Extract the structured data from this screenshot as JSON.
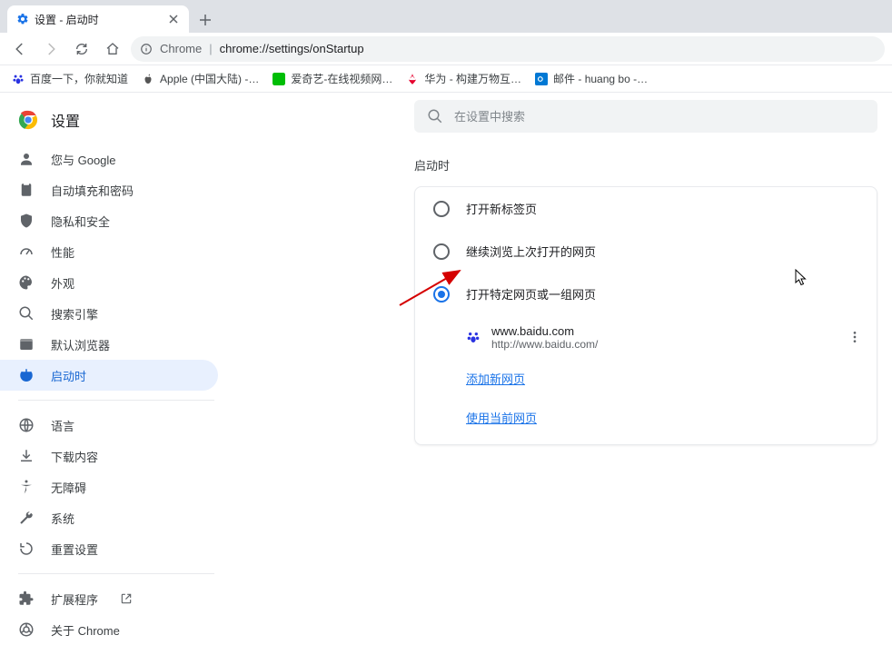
{
  "tab": {
    "title": "设置 - 启动时"
  },
  "omnibox": {
    "origin": "Chrome",
    "path": "chrome://settings/onStartup"
  },
  "bookmarks": [
    {
      "label": "百度一下，你就知道"
    },
    {
      "label": "Apple (中国大陆) -…"
    },
    {
      "label": "爱奇艺-在线视频网…"
    },
    {
      "label": "华为 - 构建万物互…"
    },
    {
      "label": "邮件 - huang bo -…"
    }
  ],
  "settings": {
    "title": "设置",
    "search_placeholder": "在设置中搜索",
    "nav": [
      {
        "id": "you-and-google",
        "label": "您与 Google"
      },
      {
        "id": "autofill",
        "label": "自动填充和密码"
      },
      {
        "id": "privacy",
        "label": "隐私和安全"
      },
      {
        "id": "performance",
        "label": "性能"
      },
      {
        "id": "appearance",
        "label": "外观"
      },
      {
        "id": "search-engine",
        "label": "搜索引擎"
      },
      {
        "id": "default-browser",
        "label": "默认浏览器"
      },
      {
        "id": "on-startup",
        "label": "启动时"
      }
    ],
    "nav2": [
      {
        "id": "languages",
        "label": "语言"
      },
      {
        "id": "downloads",
        "label": "下载内容"
      },
      {
        "id": "accessibility",
        "label": "无障碍"
      },
      {
        "id": "system",
        "label": "系统"
      },
      {
        "id": "reset",
        "label": "重置设置"
      }
    ],
    "nav3": [
      {
        "id": "extensions",
        "label": "扩展程序"
      },
      {
        "id": "about",
        "label": "关于 Chrome"
      }
    ]
  },
  "startup": {
    "section_title": "启动时",
    "options": [
      {
        "label": "打开新标签页",
        "checked": false
      },
      {
        "label": "继续浏览上次打开的网页",
        "checked": false
      },
      {
        "label": "打开特定网页或一组网页",
        "checked": true
      }
    ],
    "pages": [
      {
        "title": "www.baidu.com",
        "url": "http://www.baidu.com/"
      }
    ],
    "add_page": "添加新网页",
    "use_current": "使用当前网页"
  }
}
